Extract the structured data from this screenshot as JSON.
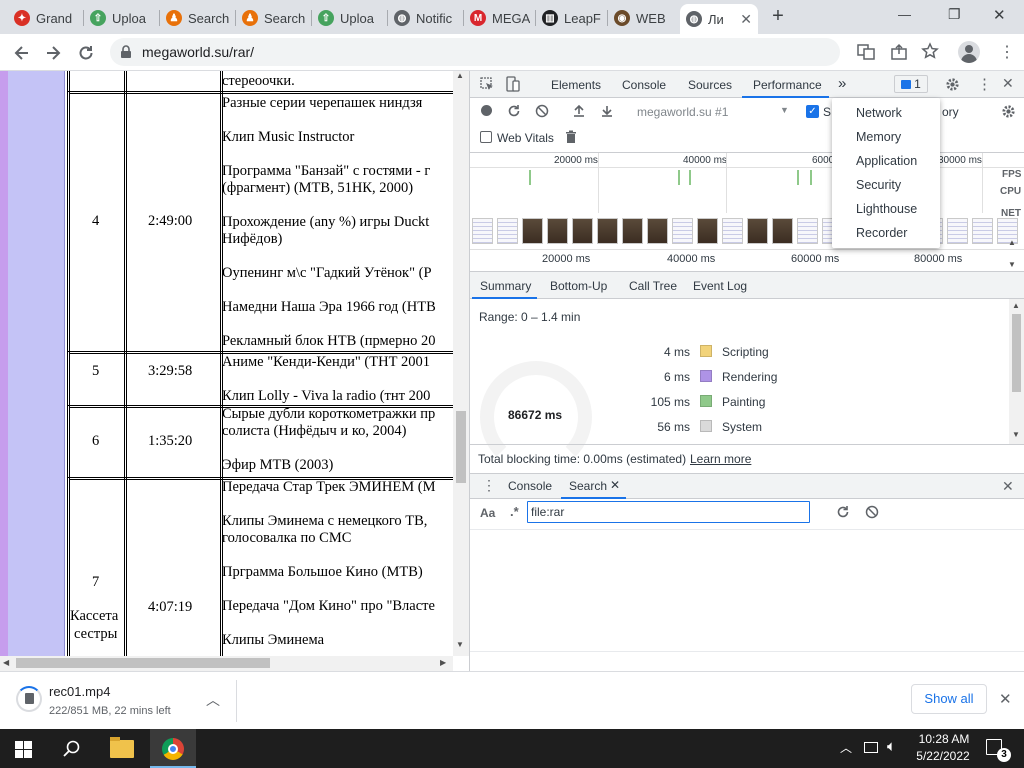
{
  "tabs": [
    {
      "label": "Grand",
      "fav": "#d93025",
      "glyph": "✦"
    },
    {
      "label": "Uploa",
      "fav": "#46a35e",
      "glyph": "⇧"
    },
    {
      "label": "Search",
      "fav": "#e8710a",
      "glyph": "♟"
    },
    {
      "label": "Search",
      "fav": "#e8710a",
      "glyph": "♟"
    },
    {
      "label": "Uploa",
      "fav": "#46a35e",
      "glyph": "⇧"
    },
    {
      "label": "Notific",
      "fav": "#5f6368",
      "glyph": "◍"
    },
    {
      "label": "MEGA",
      "fav": "#d9272e",
      "glyph": "M"
    },
    {
      "label": "LeapF",
      "fav": "#202124",
      "glyph": "▥"
    },
    {
      "label": "WEB",
      "fav": "#6b4b2a",
      "glyph": "◉"
    },
    {
      "label": "Ли",
      "fav": "#5f6368",
      "glyph": "◍"
    }
  ],
  "new_tab": "+",
  "window": {
    "min": "—",
    "restore": "❐",
    "close": "✕",
    "tab_close": "✕"
  },
  "address": {
    "url": "megaworld.su/rar/"
  },
  "page": {
    "top_text": "стереоочки.",
    "rows": [
      {
        "num": "4",
        "time": "2:49:00",
        "lines": [
          "Разные серии черепашек ниндзя",
          "",
          "Клип Music Instructor",
          "",
          "Программа \"Банзай\" с гостями - г",
          "(фрагмент) (МТВ, 51НК, 2000)",
          "",
          "Прохождение (any %) игры Duckt",
          "Нифёдов)",
          "",
          "Оупенинг м\\с \"Гадкий Утёнок\" (Р",
          "",
          "Намедни Наша Эра 1966 год (НТВ",
          "",
          "Рекламный блок НТВ (прмерно 20"
        ]
      },
      {
        "num": "5",
        "time": "3:29:58",
        "lines": [
          "Аниме \"Кенди-Кенди\" (ТНТ 2001",
          "",
          "Клип Lolly - Viva la radio (тнт 200"
        ]
      },
      {
        "num": "6",
        "time": "1:35:20",
        "lines": [
          "Сырые дубли короткометражки пр",
          "солиста (Нифёдыч и ко, 2004)",
          "",
          "Эфир МТВ (2003)"
        ]
      },
      {
        "num": "7",
        "time": "4:07:19",
        "note1": "Кассета",
        "note2": "сестры",
        "lines": [
          "Передача Стар Трек ЭМИНЕМ (М",
          "",
          "Клипы Эминема с немецкого ТВ,",
          "голосовалка по СМС",
          "",
          "Прграмма Большое Кино (МТВ)",
          "",
          "Передача \"Дом Кино\" про \"Власте",
          "",
          "Клипы Эминема"
        ]
      }
    ]
  },
  "devtools": {
    "tabs": [
      "Elements",
      "Console",
      "Sources",
      "Performance"
    ],
    "more": "»",
    "issues": "1",
    "recording": "megaworld.su #1",
    "screenshots_label": "S",
    "memory_label_partial": "ory",
    "web_vitals": "Web Vitals",
    "ruler_top": [
      "20000 ms",
      "40000 ms",
      "6000"
    ],
    "ruler_top_right": "30000 ms",
    "ruler_bottom": [
      "20000 ms",
      "40000 ms",
      "60000 ms",
      "80000 ms"
    ],
    "lane_labels": [
      "FPS",
      "CPU",
      "NET"
    ],
    "bottom_tabs": [
      "Summary",
      "Bottom-Up",
      "Call Tree",
      "Event Log"
    ],
    "range": "Range: 0 – 1.4 min",
    "total": "86672 ms",
    "summary": [
      {
        "ms": "4 ms",
        "label": "Scripting",
        "color": "#f2d37a"
      },
      {
        "ms": "6 ms",
        "label": "Rendering",
        "color": "#ae93e6"
      },
      {
        "ms": "105 ms",
        "label": "Painting",
        "color": "#8fc98a"
      },
      {
        "ms": "56 ms",
        "label": "System",
        "color": "#dadada"
      }
    ],
    "blocking": "Total blocking time: 0.00ms (estimated)",
    "learn_more": "Learn more",
    "drawer_tabs": [
      "Console",
      "Search"
    ],
    "search_case": "Aa",
    "search_regex": ".*",
    "search_value": "file:rar"
  },
  "menu": [
    "Network",
    "Memory",
    "Application",
    "Security",
    "Lighthouse",
    "Recorder"
  ],
  "download": {
    "name": "rec01.mp4",
    "status": "222/851 MB, 22 mins left",
    "show_all": "Show all"
  },
  "taskbar": {
    "time": "10:28 AM",
    "date": "5/22/2022",
    "notif": "3"
  }
}
